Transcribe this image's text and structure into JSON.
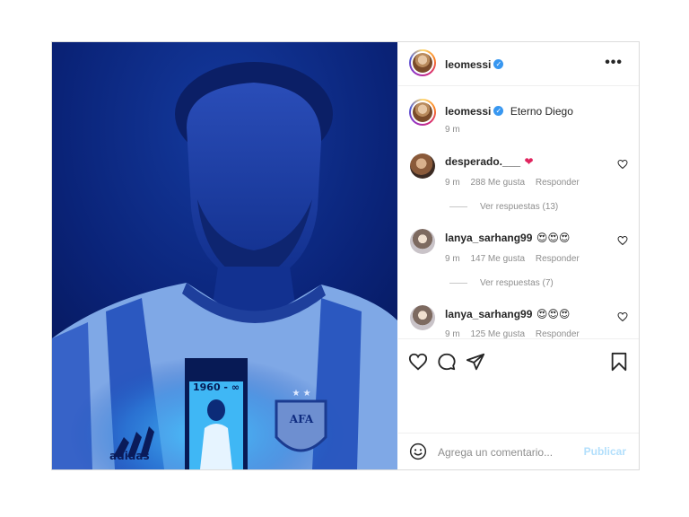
{
  "post": {
    "username": "leomessi",
    "verified_icon": "verified-badge-icon",
    "more_icon": "more-options-icon"
  },
  "caption": {
    "username": "leomessi",
    "text": "Eterno Diego",
    "time": "9 m"
  },
  "photo": {
    "shirt_text": "1960 - ∞",
    "brand_text": "adidas",
    "crest_text": "AFA"
  },
  "comments": [
    {
      "username": "desperado.___",
      "text": "❤",
      "time": "9 m",
      "likes": "288 Me gusta",
      "reply": "Responder",
      "view_replies": "Ver respuestas (13)"
    },
    {
      "username": "lanya_sarhang99",
      "text": "😍😍😍",
      "time": "9 m",
      "likes": "147 Me gusta",
      "reply": "Responder",
      "view_replies": "Ver respuestas (7)"
    },
    {
      "username": "lanya_sarhang99",
      "text": "😍😍😍",
      "time": "9 m",
      "likes": "125 Me gusta",
      "reply": "Responder"
    }
  ],
  "add_comment": {
    "placeholder": "Agrega un comentario...",
    "publish": "Publicar",
    "emoji_icon": "emoji-icon"
  },
  "colors": {
    "photo_bg": "#0a1e6e",
    "verified": "#3897f0",
    "publish_disabled": "#b2dffc"
  }
}
